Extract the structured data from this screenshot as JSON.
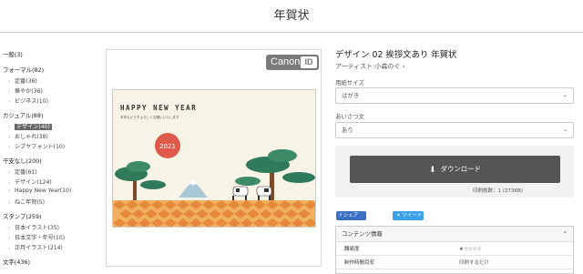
{
  "page": {
    "title": "年賀状"
  },
  "sidebar": {
    "categories": [
      {
        "label": "一般(3)",
        "items": []
      },
      {
        "label": "フォーマル(82)",
        "items": [
          {
            "label": "定番(36)"
          },
          {
            "label": "華やか(36)"
          },
          {
            "label": "ビジネス(10)"
          }
        ]
      },
      {
        "label": "カジュアル(88)",
        "items": [
          {
            "label": "デザイン(40)",
            "active": true
          },
          {
            "label": "おしゃれ(38)"
          },
          {
            "label": "シブヤフォント(10)"
          }
        ]
      },
      {
        "label": "干支なし(200)",
        "items": [
          {
            "label": "定番(61)"
          },
          {
            "label": "デザイン(124)"
          },
          {
            "label": "Happy New Year(10)"
          },
          {
            "label": "ねこ年賀(5)"
          }
        ]
      },
      {
        "label": "スタンプ(259)",
        "items": [
          {
            "label": "日本イラスト(35)"
          },
          {
            "label": "日本文字・年号(10)"
          },
          {
            "label": "正月イラスト(214)"
          }
        ]
      },
      {
        "label": "文字(436)",
        "items": []
      }
    ]
  },
  "preview": {
    "logo_text": "Canon",
    "logo_badge": "ID",
    "card_heading": "HAPPY NEW YEAR",
    "card_message": "本年もどうぞよろしくお願いいたします",
    "card_year": "2021"
  },
  "product": {
    "title": "デザイン 02 挨拶文あり 年賀状",
    "artist": "アーティスト:小森のぐ ›",
    "paper_size_label": "用紙サイズ",
    "paper_size_value": "はがき",
    "greeting_label": "あいさつ文",
    "greeting_value": "あり",
    "download_label": "ダウンロード",
    "print_count": "印刷枚数：1 (273KB)",
    "share_fb": "f シェア",
    "share_tw": "ツイート",
    "info_header": "コンテンツ情報",
    "info_rows": [
      {
        "key": "難易度",
        "value": "★☆☆☆☆"
      },
      {
        "key": "制作時間目安",
        "value": "印刷するだけ"
      }
    ]
  },
  "colors": {
    "accent_dark": "#555555",
    "facebook": "#3b6fc4",
    "twitter": "#3aa0e8",
    "card_sun": "#e05a4c"
  }
}
